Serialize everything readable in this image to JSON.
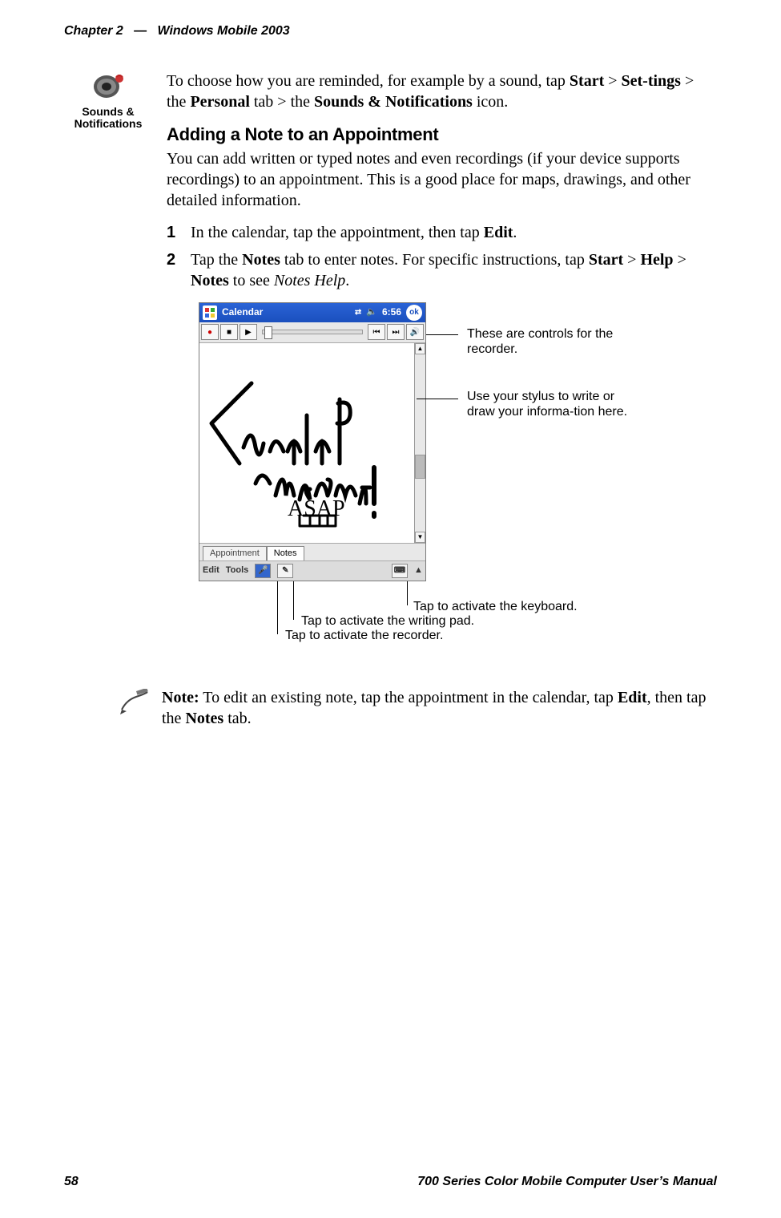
{
  "header": {
    "chapter": "Chapter 2",
    "dash": "—",
    "title": "Windows Mobile 2003"
  },
  "sidebar": {
    "sounds_label_1": "Sounds &",
    "sounds_label_2": "Notifications"
  },
  "intro": {
    "line1_a": "To choose how you are reminded, for example by a sound, tap ",
    "start": "Start",
    "gt": " > ",
    "settings": "Set-tings",
    "line1_b": " > the ",
    "personal": "Personal",
    "line1_c": " tab > the ",
    "sni": "Sounds & Notifications",
    "line1_d": " icon."
  },
  "section_heading": "Adding a Note to an Appointment",
  "section_body": "You can add written or typed notes and even recordings (if your device supports recordings) to an appointment. This is a good place for maps, drawings, and other detailed information.",
  "steps": [
    {
      "num": "1",
      "pre": "In the calendar, tap the appointment, then tap ",
      "b1": "Edit",
      "post": "."
    },
    {
      "num": "2",
      "pre": "Tap the ",
      "b1": "Notes",
      "mid1": " tab to enter notes. For specific instructions, tap ",
      "b2": "Start",
      "mid2": " > ",
      "b3": "Help",
      "mid3": " > ",
      "b4": "Notes",
      "mid4": " to see ",
      "i1": "Notes Help",
      "post": "."
    }
  ],
  "pda": {
    "title": "Calendar",
    "time": "6:56",
    "ok": "ok",
    "tabs": {
      "appointment": "Appointment",
      "notes": "Notes"
    },
    "bottombar": {
      "edit": "Edit",
      "tools": "Tools"
    }
  },
  "callouts": {
    "recorder_controls": "These are controls for the recorder.",
    "stylus": "Use your stylus to write or draw your informa-tion here.",
    "keyboard": "Tap to activate the keyboard.",
    "writing_pad": "Tap to activate the writing pad.",
    "recorder": "Tap to activate the recorder."
  },
  "note": {
    "label": "Note:",
    "body_a": " To edit an existing note, tap the appointment in the calendar, tap ",
    "b1": "Edit",
    "body_b": ", then tap the ",
    "b2": "Notes",
    "body_c": " tab."
  },
  "footer": {
    "page": "58",
    "manual": "700 Series Color Mobile Computer User’s Manual"
  }
}
